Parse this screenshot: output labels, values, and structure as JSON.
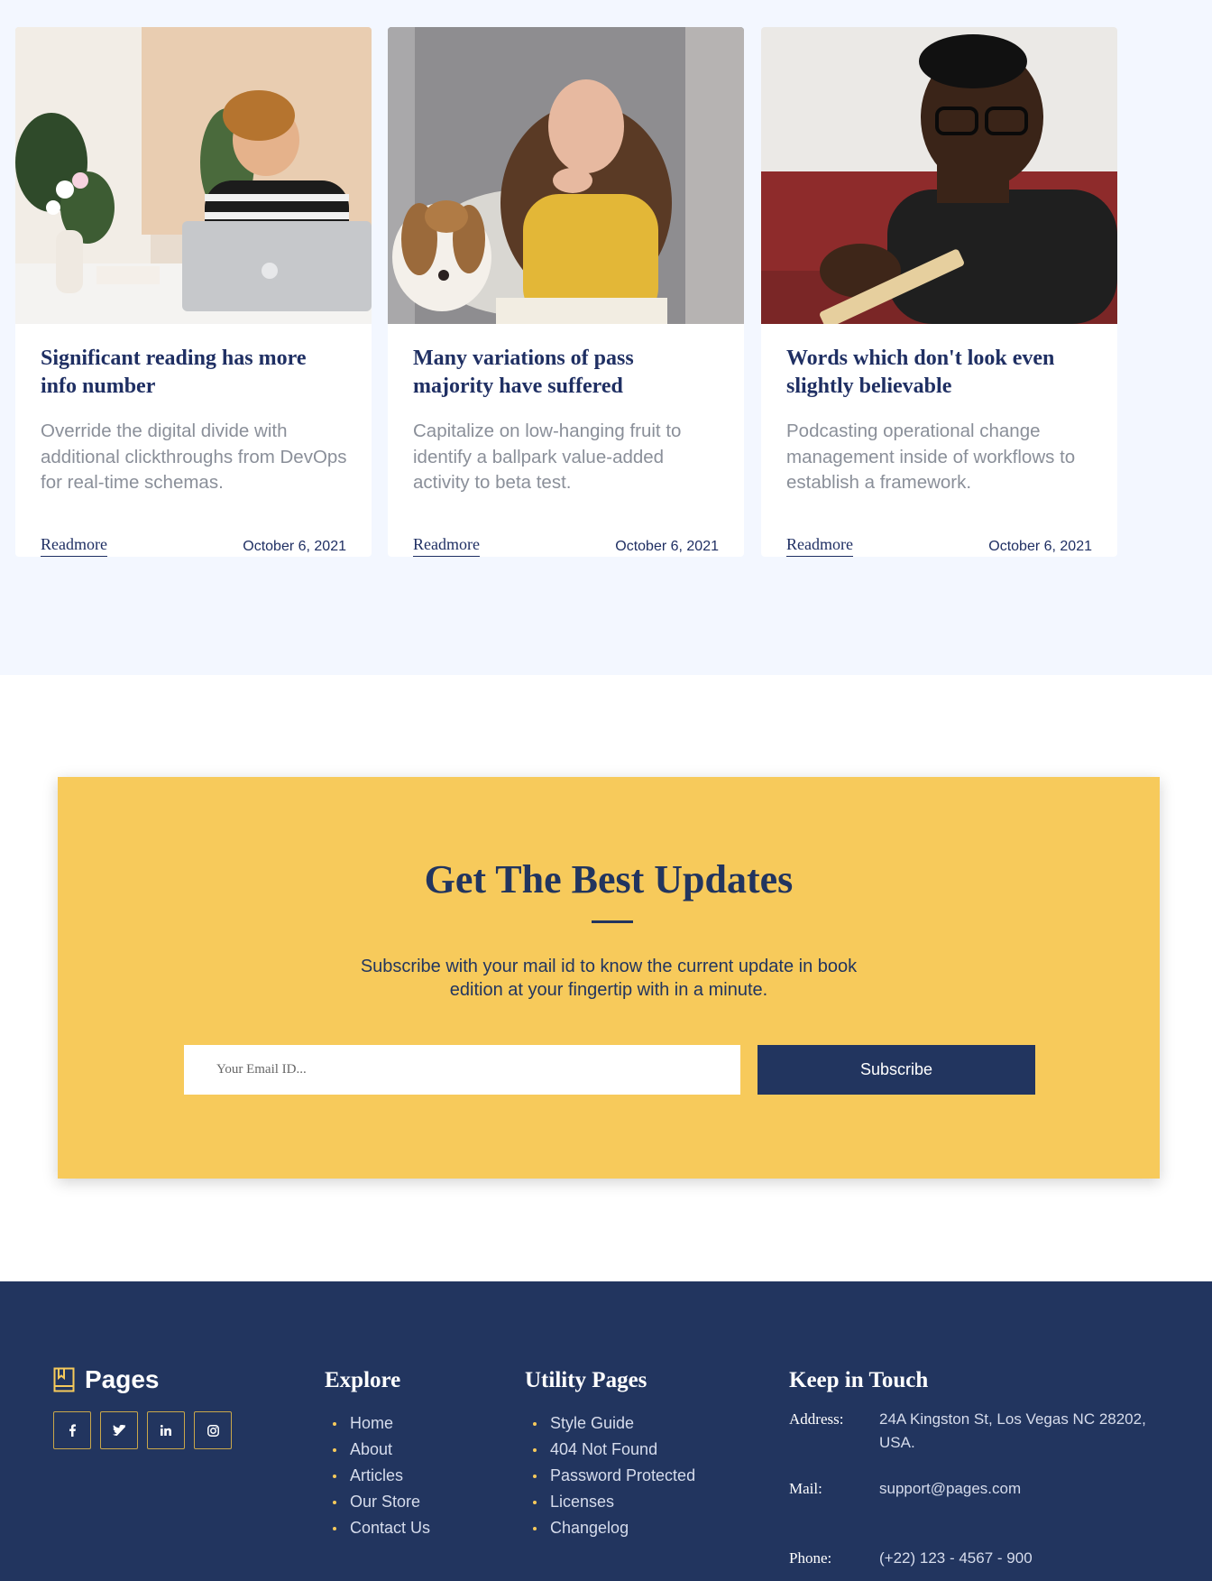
{
  "blog": {
    "cards": [
      {
        "title": "Significant reading has more info number",
        "excerpt": "Override the digital divide with additional clickthroughs from DevOps for real-time schemas.",
        "readmore": "Readmore",
        "date": "October 6, 2021"
      },
      {
        "title": "Many variations of pass majority have suffered",
        "excerpt": "Capitalize on low-hanging fruit to identify a ballpark value-added activity to beta test.",
        "readmore": "Readmore",
        "date": "October 6, 2021"
      },
      {
        "title": "Words which don't look even slightly believable",
        "excerpt": "Podcasting operational change management inside of workflows to establish a framework.",
        "readmore": "Readmore",
        "date": "October 6, 2021"
      }
    ]
  },
  "newsletter": {
    "title": "Get The Best Updates",
    "text": "Subscribe with your mail id to know the current update in book edition at your fingertip with in a minute.",
    "email_placeholder": "Your Email ID...",
    "button_label": "Subscribe",
    "accent_color": "#f7ca5b"
  },
  "footer": {
    "brand": "Pages",
    "social": [
      {
        "icon": "facebook-icon",
        "glyph": "f"
      },
      {
        "icon": "twitter-icon",
        "glyph": "t"
      },
      {
        "icon": "linkedin-icon",
        "glyph": "in"
      },
      {
        "icon": "instagram-icon",
        "glyph": "ig"
      }
    ],
    "explore": {
      "title": "Explore",
      "items": [
        "Home",
        "About",
        "Articles",
        "Our Store",
        "Contact Us"
      ]
    },
    "utility": {
      "title": "Utility Pages",
      "items": [
        "Style Guide",
        "404 Not Found",
        "Password Protected",
        "Licenses",
        "Changelog"
      ]
    },
    "contact": {
      "title": "Keep in Touch",
      "address_label": "Address:",
      "address": "24A Kingston St, Los Vegas NC 28202, USA.",
      "mail_label": "Mail:",
      "mail": "support@pages.com",
      "phone_label": "Phone:",
      "phone": "(+22) 123 - 4567 - 900"
    },
    "bg_color": "#22355f"
  }
}
